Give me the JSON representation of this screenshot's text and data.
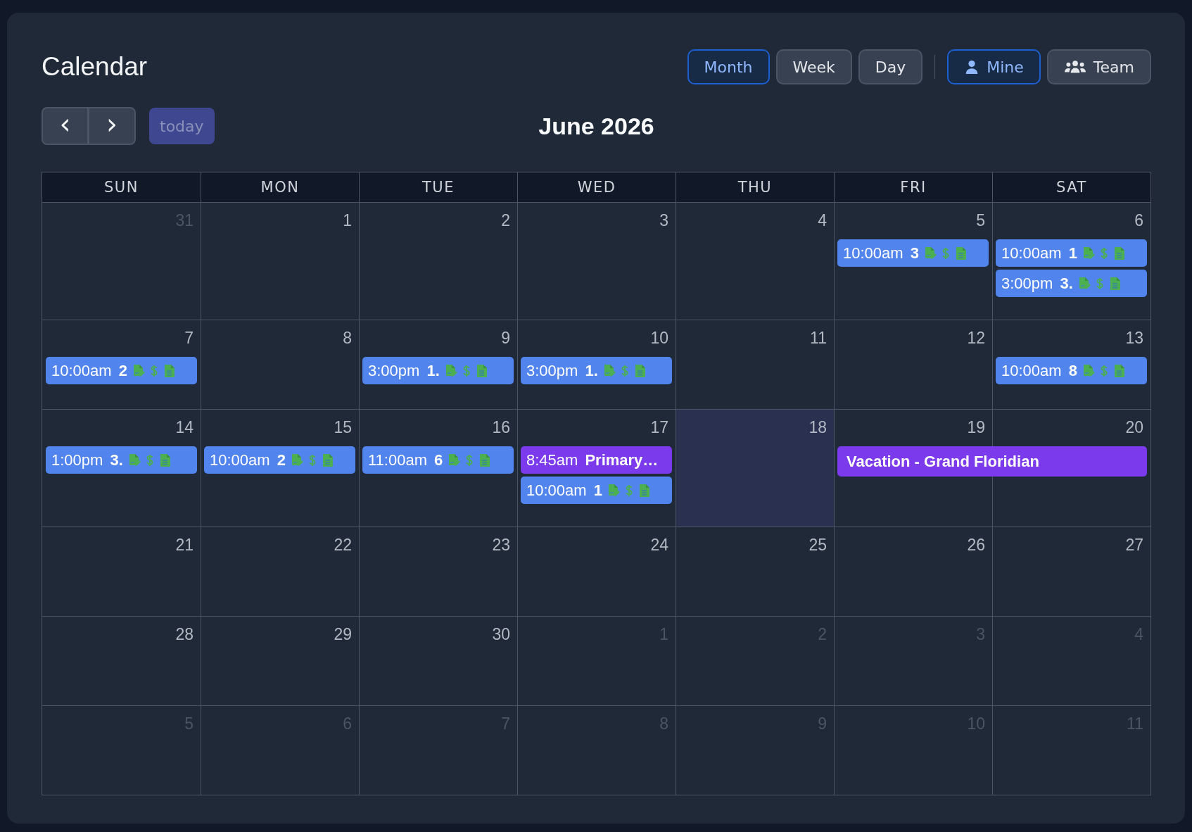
{
  "title": "Calendar",
  "views": [
    {
      "label": "Month",
      "selected": true
    },
    {
      "label": "Week",
      "selected": false
    },
    {
      "label": "Day",
      "selected": false
    }
  ],
  "filters": [
    {
      "label": "Mine",
      "kind": "person",
      "selected": true
    },
    {
      "label": "Team",
      "kind": "group",
      "selected": false
    }
  ],
  "nav": {
    "prev": "‹",
    "next": "›",
    "today": {
      "label": "today",
      "disabled": true
    }
  },
  "period": "June 2026",
  "weekdays": [
    "SUN",
    "MON",
    "TUE",
    "WED",
    "THU",
    "FRI",
    "SAT"
  ],
  "weeks": [
    {
      "days": [
        {
          "label": "31",
          "muted": true,
          "today": false
        },
        {
          "label": "1",
          "muted": false,
          "today": false
        },
        {
          "label": "2",
          "muted": false,
          "today": false
        },
        {
          "label": "3",
          "muted": false,
          "today": false
        },
        {
          "label": "4",
          "muted": false,
          "today": false
        },
        {
          "label": "5",
          "muted": false,
          "today": false,
          "events": [
            {
              "kind": "appointment",
              "time": "10:00am",
              "title": "3"
            }
          ]
        },
        {
          "label": "6",
          "muted": false,
          "today": false,
          "events": [
            {
              "kind": "appointment",
              "time": "10:00am",
              "title": "1"
            },
            {
              "kind": "appointment",
              "time": "3:00pm",
              "title": "3."
            }
          ]
        }
      ]
    },
    {
      "days": [
        {
          "label": "7",
          "muted": false,
          "today": false,
          "events": [
            {
              "kind": "appointment",
              "time": "10:00am",
              "title": "2"
            }
          ]
        },
        {
          "label": "8",
          "muted": false,
          "today": false
        },
        {
          "label": "9",
          "muted": false,
          "today": false,
          "events": [
            {
              "kind": "appointment",
              "time": "3:00pm",
              "title": "1."
            }
          ]
        },
        {
          "label": "10",
          "muted": false,
          "today": false,
          "events": [
            {
              "kind": "appointment",
              "time": "3:00pm",
              "title": "1."
            }
          ]
        },
        {
          "label": "11",
          "muted": false,
          "today": false
        },
        {
          "label": "12",
          "muted": false,
          "today": false
        },
        {
          "label": "13",
          "muted": false,
          "today": false,
          "events": [
            {
              "kind": "appointment",
              "time": "10:00am",
              "title": "8"
            }
          ]
        }
      ]
    },
    {
      "days": [
        {
          "label": "14",
          "muted": false,
          "today": false,
          "events": [
            {
              "kind": "appointment",
              "time": "1:00pm",
              "title": "3."
            }
          ]
        },
        {
          "label": "15",
          "muted": false,
          "today": false,
          "events": [
            {
              "kind": "appointment",
              "time": "10:00am",
              "title": "2"
            }
          ]
        },
        {
          "label": "16",
          "muted": false,
          "today": false,
          "events": [
            {
              "kind": "appointment",
              "time": "11:00am",
              "title": "6"
            }
          ]
        },
        {
          "label": "17",
          "muted": false,
          "today": false,
          "events": [
            {
              "kind": "personal",
              "time": "8:45am",
              "title": "Primary…"
            },
            {
              "kind": "appointment",
              "time": "10:00am",
              "title": "1"
            }
          ]
        },
        {
          "label": "18",
          "muted": false,
          "today": true
        },
        {
          "label": "19",
          "muted": false,
          "today": false,
          "events": [
            {
              "kind": "multi-day",
              "title": "Vacation - Grand Floridian"
            }
          ]
        },
        {
          "label": "20",
          "muted": false,
          "today": false
        }
      ]
    },
    {
      "days": [
        {
          "label": "21",
          "muted": false,
          "today": false
        },
        {
          "label": "22",
          "muted": false,
          "today": false
        },
        {
          "label": "23",
          "muted": false,
          "today": false
        },
        {
          "label": "24",
          "muted": false,
          "today": false
        },
        {
          "label": "25",
          "muted": false,
          "today": false
        },
        {
          "label": "26",
          "muted": false,
          "today": false
        },
        {
          "label": "27",
          "muted": false,
          "today": false
        }
      ]
    },
    {
      "days": [
        {
          "label": "28",
          "muted": false,
          "today": false
        },
        {
          "label": "29",
          "muted": false,
          "today": false
        },
        {
          "label": "30",
          "muted": false,
          "today": false
        },
        {
          "label": "1",
          "muted": true,
          "today": false
        },
        {
          "label": "2",
          "muted": true,
          "today": false
        },
        {
          "label": "3",
          "muted": true,
          "today": false
        },
        {
          "label": "4",
          "muted": true,
          "today": false
        }
      ]
    },
    {
      "days": [
        {
          "label": "5",
          "muted": true,
          "today": false
        },
        {
          "label": "6",
          "muted": true,
          "today": false
        },
        {
          "label": "7",
          "muted": true,
          "today": false
        },
        {
          "label": "8",
          "muted": true,
          "today": false
        },
        {
          "label": "9",
          "muted": true,
          "today": false
        },
        {
          "label": "10",
          "muted": true,
          "today": false
        },
        {
          "label": "11",
          "muted": true,
          "today": false
        }
      ]
    }
  ]
}
